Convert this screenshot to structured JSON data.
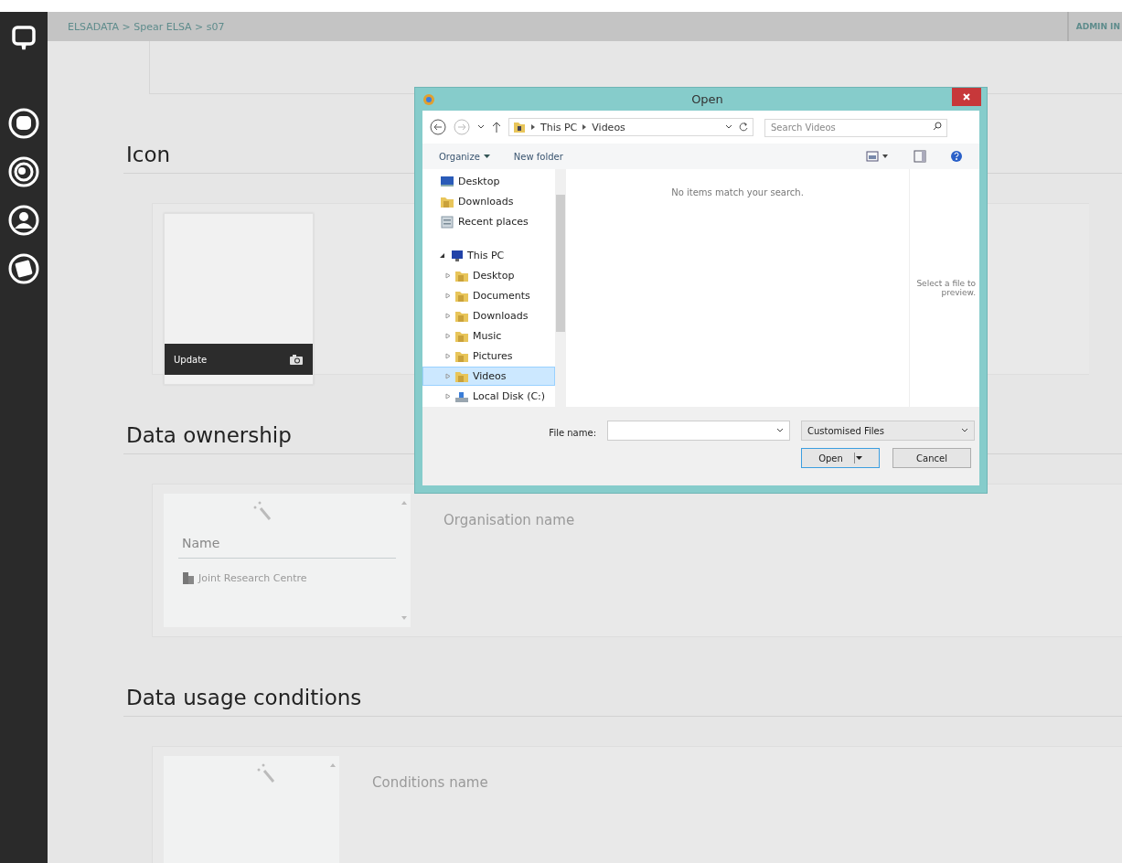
{
  "breadcrumb": "ELSADATA > Spear ELSA > s07",
  "user_menu": "ADMIN IN",
  "sections": [
    {
      "kind": "icon",
      "title": "Icon",
      "update_label": "Update"
    },
    {
      "kind": "list",
      "title": "Data ownership",
      "list_header": "Name",
      "items": [
        {
          "label": "Joint Research Centre"
        }
      ],
      "field_label": "Organisation name"
    },
    {
      "kind": "list",
      "title": "Data usage conditions",
      "field_label": "Conditions name"
    }
  ],
  "dialog": {
    "title": "Open",
    "path": [
      "This PC",
      "Videos"
    ],
    "search": {
      "placeholder": "Search Videos"
    },
    "toolbar": [
      "Organize",
      "New folder"
    ],
    "nav": [
      {
        "label": "Desktop",
        "kind": "desktop",
        "selected": false
      },
      {
        "label": "Downloads",
        "kind": "download",
        "selected": false
      },
      {
        "label": "Recent places",
        "kind": "recent",
        "selected": false
      },
      {
        "label": "This PC",
        "kind": "pc",
        "selected": false,
        "expanded": true,
        "children": [
          {
            "label": "Desktop",
            "kind": "folder",
            "selected": false,
            "expanded": false
          },
          {
            "label": "Documents",
            "kind": "folder",
            "selected": false,
            "expanded": false
          },
          {
            "label": "Downloads",
            "kind": "folder",
            "selected": false,
            "expanded": false
          },
          {
            "label": "Music",
            "kind": "folder",
            "selected": false,
            "expanded": false
          },
          {
            "label": "Pictures",
            "kind": "folder",
            "selected": false,
            "expanded": false
          },
          {
            "label": "Videos",
            "kind": "folder",
            "selected": true,
            "expanded": false
          },
          {
            "label": "Local Disk (C:)",
            "kind": "disk",
            "selected": false,
            "expanded": false
          }
        ]
      }
    ],
    "empty_message": "No items match your search.",
    "preview_message": "Select a file to preview.",
    "file_name_label": "File name:",
    "file_type": "Customised Files",
    "buttons": [
      "Open",
      "Cancel"
    ]
  }
}
